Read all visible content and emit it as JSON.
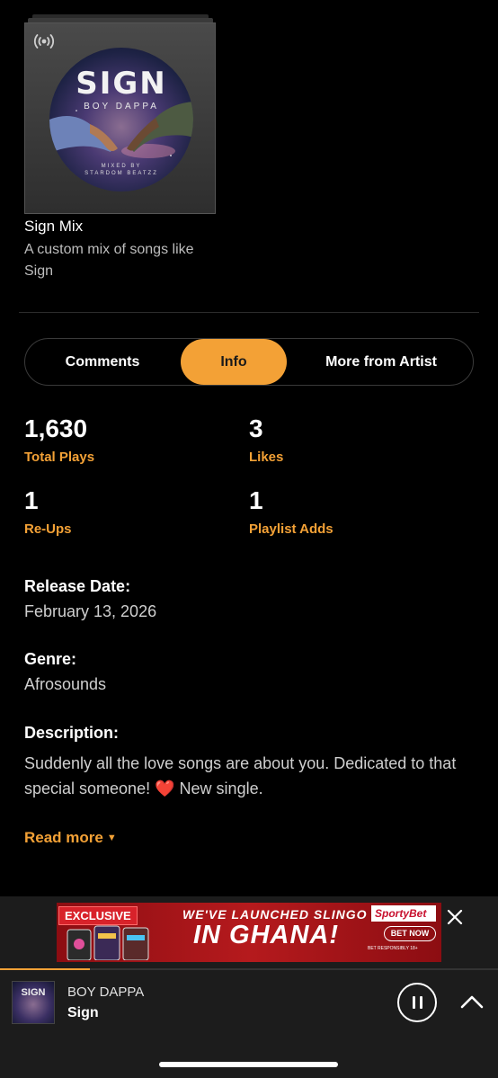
{
  "mix": {
    "art_title": "SIGN",
    "art_artist": "BOY DAPPA",
    "art_credit_line1": "MIXED BY",
    "art_credit_line2": "STARDOM BEATZZ",
    "title": "Sign Mix",
    "description": "A custom mix of songs like Sign"
  },
  "tabs": [
    {
      "label": "Comments",
      "active": false
    },
    {
      "label": "Info",
      "active": true
    },
    {
      "label": "More from Artist",
      "active": false
    }
  ],
  "stats": {
    "total_plays": {
      "value": "1,630",
      "label": "Total Plays"
    },
    "likes": {
      "value": "3",
      "label": "Likes"
    },
    "reups": {
      "value": "1",
      "label": "Re-Ups"
    },
    "playlist_adds": {
      "value": "1",
      "label": "Playlist Adds"
    }
  },
  "info": {
    "release_label": "Release Date:",
    "release_value": "February 13, 2026",
    "genre_label": "Genre:",
    "genre_value": "Afrosounds",
    "description_label": "Description:",
    "description_text": "Suddenly all the love songs are about you. Dedicated to that special someone!",
    "description_emoji": "❤️",
    "description_tail": "New single.",
    "read_more": "Read more"
  },
  "ad": {
    "badge": "EXCLUSIVE",
    "headline1": "WE'VE LAUNCHED SLINGO",
    "headline2": "IN GHANA!",
    "brand": "SportyBet",
    "cta": "BET NOW",
    "fine_print": "BET RESPONSIBLY 18+"
  },
  "player": {
    "art_title": "SIGN",
    "artist": "BOY DAPPA",
    "song": "Sign",
    "progress_fraction": 0.18
  },
  "colors": {
    "accent": "#f3a136",
    "background": "#000000",
    "bar": "#1c1c1c"
  },
  "icons": {
    "broadcast": "broadcast-icon",
    "close": "close-icon",
    "pause": "pause-icon",
    "expand": "chevron-up-icon",
    "caret": "caret-down-icon",
    "heart": "heart-icon"
  }
}
